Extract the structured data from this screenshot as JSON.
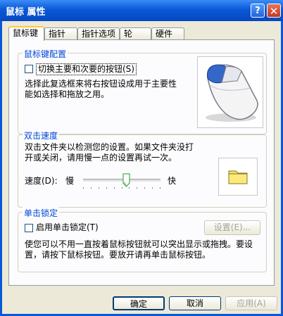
{
  "window": {
    "title": "鼠标 属性",
    "help_glyph": "?",
    "close_glyph": "✕"
  },
  "tabs": [
    {
      "label": "鼠标键"
    },
    {
      "label": "指针"
    },
    {
      "label": "指针选项"
    },
    {
      "label": "轮"
    },
    {
      "label": "硬件"
    }
  ],
  "button_config": {
    "title": "鼠标键配置",
    "switch_checkbox_label": "切换主要和次要的按钮(S)",
    "switch_checked": false,
    "description": "选择此复选框来将右按钮设成用于主要性能如选择和拖放之用。"
  },
  "double_click": {
    "title": "双击速度",
    "description": "双击文件夹以检测您的设置。如果文件夹没打开或关闭，请用慢一点的设置再试一次。",
    "speed_label": "速度(D):",
    "slow_label": "慢",
    "fast_label": "快",
    "speed_value_fraction": 0.57
  },
  "click_lock": {
    "title": "单击锁定",
    "checkbox_label": "启用单击锁定(T)",
    "checked": false,
    "settings_button": "设置(E)...",
    "description": "使您可以不用一直按着鼠标按钮就可以突出显示或拖拽。要设置，请按下鼠标按钮。要放开请再单击鼠标按钮。"
  },
  "footer": {
    "ok": "确定",
    "cancel": "取消",
    "apply": "应用(A)"
  },
  "colors": {
    "titlebar": "#0a58d6",
    "group_title": "#0046d5",
    "folder": "#f8e060"
  }
}
